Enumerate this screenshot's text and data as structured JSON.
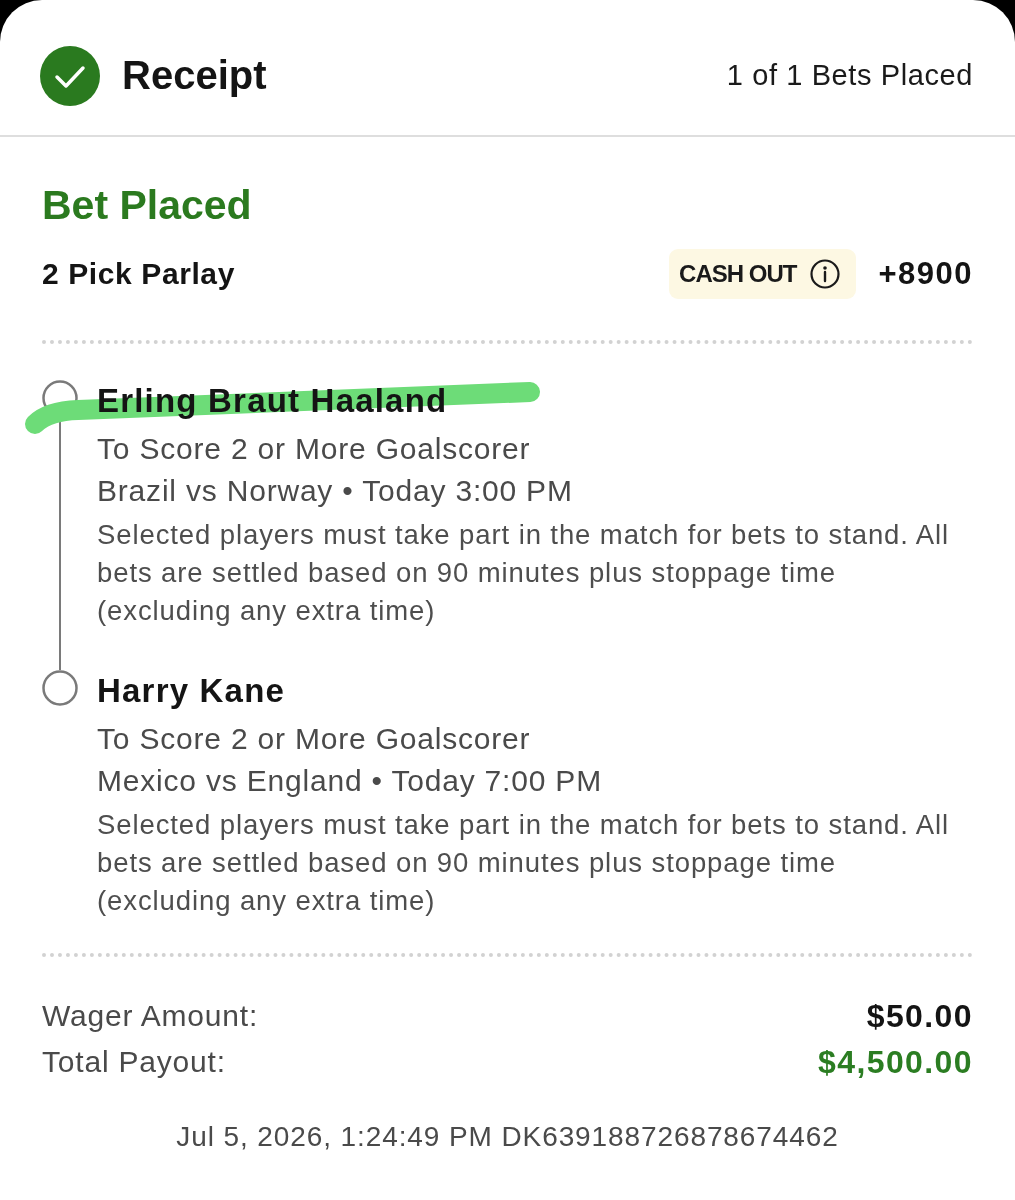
{
  "header": {
    "title": "Receipt",
    "status": "1 of 1 Bets Placed"
  },
  "bet": {
    "status": "Bet Placed",
    "type": "2 Pick Parlay",
    "cash_out": {
      "label": "CASH OUT"
    },
    "odds": "+8900"
  },
  "legs": [
    {
      "player": "Erling Braut Haaland",
      "highlighted": true,
      "market": "To Score 2 or More Goalscorer",
      "event": "Brazil vs Norway • Today 3:00 PM",
      "terms": "Selected players must take part in the match for bets to stand. All bets are settled based on 90 minutes plus stoppage time (excluding any extra time)"
    },
    {
      "player": "Harry Kane",
      "highlighted": false,
      "market": "To Score 2 or More Goalscorer",
      "event": "Mexico vs England • Today 7:00 PM",
      "terms": "Selected players must take part in the match for bets to stand. All bets are settled based on 90 minutes plus stoppage time (excluding any extra time)"
    }
  ],
  "totals": [
    {
      "kind": "wager",
      "label": "Wager Amount:",
      "value": "$50.00"
    },
    {
      "kind": "payout",
      "label": "Total Payout:",
      "value": "$4,500.00"
    }
  ],
  "footer": "Jul 5, 2026, 1:24:49 PM DK639188726878674462"
}
